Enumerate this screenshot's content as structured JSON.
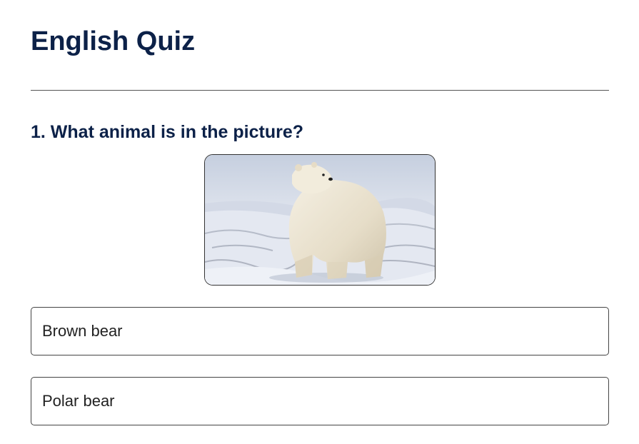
{
  "quiz": {
    "title": "English Quiz",
    "questions": [
      {
        "number_and_text": "1. What animal is in the picture?",
        "image_subject": "polar-bear-image",
        "options": [
          {
            "label": "Brown bear"
          },
          {
            "label": "Polar bear"
          }
        ]
      }
    ]
  },
  "colors": {
    "heading": "#0c2148",
    "text": "#222222",
    "border": "#444444",
    "background": "#ffffff"
  }
}
